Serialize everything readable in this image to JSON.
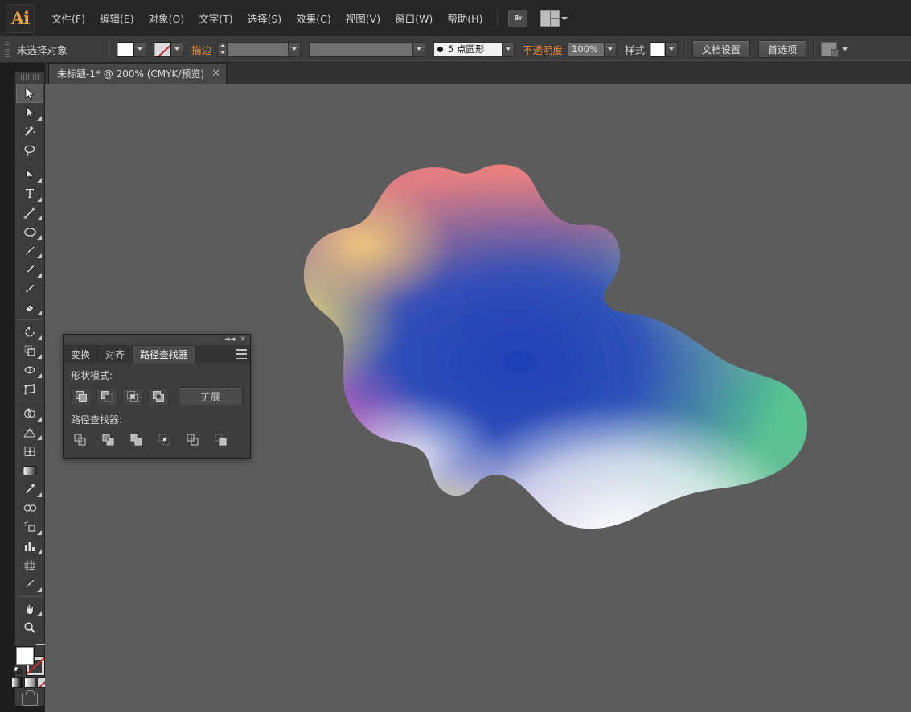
{
  "app": {
    "name": "Adobe Illustrator",
    "logo_text": "Ai"
  },
  "menubar": {
    "items": [
      {
        "label": "文件(F)",
        "name": "menu-file"
      },
      {
        "label": "编辑(E)",
        "name": "menu-edit"
      },
      {
        "label": "对象(O)",
        "name": "menu-object"
      },
      {
        "label": "文字(T)",
        "name": "menu-type"
      },
      {
        "label": "选择(S)",
        "name": "menu-select"
      },
      {
        "label": "效果(C)",
        "name": "menu-effect"
      },
      {
        "label": "视图(V)",
        "name": "menu-view"
      },
      {
        "label": "窗口(W)",
        "name": "menu-window"
      },
      {
        "label": "帮助(H)",
        "name": "menu-help"
      }
    ],
    "bridge_label": "Br"
  },
  "options_bar": {
    "selection_status": "未选择对象",
    "fill_color": "#ffffff",
    "stroke_color": "none",
    "stroke_label": "描边",
    "stroke_weight": "",
    "stroke_profile": "",
    "brush_definition": "5 点圆形",
    "opacity_label": "不透明度",
    "opacity_value": "100%",
    "style_label": "样式",
    "document_setup": "文档设置",
    "preferences": "首选项"
  },
  "tabbar": {
    "documents": [
      {
        "title": "未标题-1* @ 200% (CMYK/预览)",
        "close": "✕",
        "active": true
      }
    ]
  },
  "toolbar": {
    "tools": [
      {
        "name": "selection-tool",
        "selected": true,
        "has_flyout": false
      },
      {
        "name": "direct-selection-tool",
        "selected": false,
        "has_flyout": true
      },
      {
        "name": "magic-wand-tool",
        "selected": false,
        "has_flyout": false
      },
      {
        "name": "lasso-tool",
        "selected": false,
        "has_flyout": false
      },
      {
        "name": "pen-tool",
        "selected": false,
        "has_flyout": true
      },
      {
        "name": "type-tool",
        "selected": false,
        "has_flyout": true
      },
      {
        "name": "line-segment-tool",
        "selected": false,
        "has_flyout": true
      },
      {
        "name": "ellipse-tool",
        "selected": false,
        "has_flyout": true
      },
      {
        "name": "paintbrush-tool",
        "selected": false,
        "has_flyout": true
      },
      {
        "name": "pencil-tool",
        "selected": false,
        "has_flyout": true
      },
      {
        "name": "blob-brush-tool",
        "selected": false,
        "has_flyout": false
      },
      {
        "name": "eraser-tool",
        "selected": false,
        "has_flyout": true
      },
      {
        "name": "rotate-tool",
        "selected": false,
        "has_flyout": true
      },
      {
        "name": "scale-tool",
        "selected": false,
        "has_flyout": true
      },
      {
        "name": "width-tool",
        "selected": false,
        "has_flyout": true
      },
      {
        "name": "free-transform-tool",
        "selected": false,
        "has_flyout": false
      },
      {
        "name": "shape-builder-tool",
        "selected": false,
        "has_flyout": true
      },
      {
        "name": "perspective-grid-tool",
        "selected": false,
        "has_flyout": true
      },
      {
        "name": "mesh-tool",
        "selected": false,
        "has_flyout": false
      },
      {
        "name": "gradient-tool",
        "selected": false,
        "has_flyout": false
      },
      {
        "name": "eyedropper-tool",
        "selected": false,
        "has_flyout": true
      },
      {
        "name": "blend-tool",
        "selected": false,
        "has_flyout": false
      },
      {
        "name": "symbol-sprayer-tool",
        "selected": false,
        "has_flyout": true
      },
      {
        "name": "column-graph-tool",
        "selected": false,
        "has_flyout": true
      },
      {
        "name": "artboard-tool",
        "selected": false,
        "has_flyout": false
      },
      {
        "name": "slice-tool",
        "selected": false,
        "has_flyout": true
      },
      {
        "name": "hand-tool",
        "selected": false,
        "has_flyout": true
      },
      {
        "name": "zoom-tool",
        "selected": false,
        "has_flyout": false
      }
    ],
    "fill_color": "#ffffff",
    "stroke_color": "none"
  },
  "pathfinder_panel": {
    "tabs": [
      {
        "label": "变换",
        "active": false
      },
      {
        "label": "对齐",
        "active": false
      },
      {
        "label": "路径查找器",
        "active": true
      }
    ],
    "collapse_glyph": "◄◄",
    "close_glyph": "✕",
    "shape_modes_label": "形状模式:",
    "shape_modes": [
      {
        "name": "unite-button"
      },
      {
        "name": "minus-front-button"
      },
      {
        "name": "intersect-button"
      },
      {
        "name": "exclude-button"
      }
    ],
    "expand_label": "扩展",
    "pathfinders_label": "路径查找器:",
    "pathfinders": [
      {
        "name": "divide-button"
      },
      {
        "name": "trim-button"
      },
      {
        "name": "merge-button"
      },
      {
        "name": "crop-button"
      },
      {
        "name": "outline-button"
      },
      {
        "name": "minus-back-button"
      }
    ]
  },
  "canvas": {
    "background_color": "#5c5c5c",
    "zoom": "200%",
    "color_mode": "CMYK",
    "view_mode": "预览",
    "artwork": {
      "name": "gradient-mesh-blob",
      "description": "有机形状渐变网格图形",
      "gradient_stops": [
        {
          "color": "#ef7f7a",
          "position": "top"
        },
        {
          "color": "#2b4fb5",
          "position": "center"
        },
        {
          "color": "#5fc994",
          "position": "right"
        },
        {
          "color": "#e8e06a",
          "position": "left-edge"
        },
        {
          "color": "#c763c0",
          "position": "lower-left"
        },
        {
          "color": "#ffffff",
          "position": "bottom"
        }
      ]
    }
  }
}
